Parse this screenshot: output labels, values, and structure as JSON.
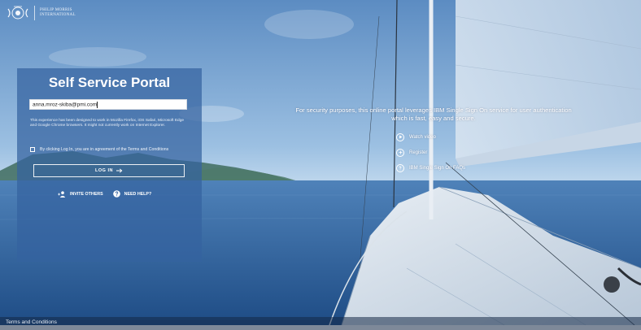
{
  "brand": {
    "name": "PHILIP MORRIS\nINTERNATIONAL"
  },
  "login_panel": {
    "title": "Self Service Portal",
    "email_value": "anna.mroz-skiba@pmi.com",
    "browser_notice": "This experience has been designed to work in Mozilla Firefox, iOS Safari, Microsoft Edge and Google Chrome browsers. It might not currently work on Internet Explorer.",
    "agreement_text": "By clicking Log In, you are in agreement of the Terms and Conditions",
    "login_label": "LOG IN",
    "invite_label": "INVITE OTHERS",
    "help_label": "NEED HELP?"
  },
  "info": {
    "security_text": "For security purposes, this online portal leverages IBM Single Sign On service for user authentication which is fast, easy and secure.",
    "links": [
      {
        "label": "Watch video",
        "icon": "play-icon"
      },
      {
        "label": "Register",
        "icon": "register-icon"
      },
      {
        "label": "IBM Single Sign On FAQs",
        "icon": "faq-icon"
      }
    ]
  },
  "footer": {
    "terms_label": "Terms and Conditions"
  },
  "colors": {
    "panel": "#3562a0",
    "sky": "#6f9dcc",
    "sea": "#2c5e96"
  }
}
